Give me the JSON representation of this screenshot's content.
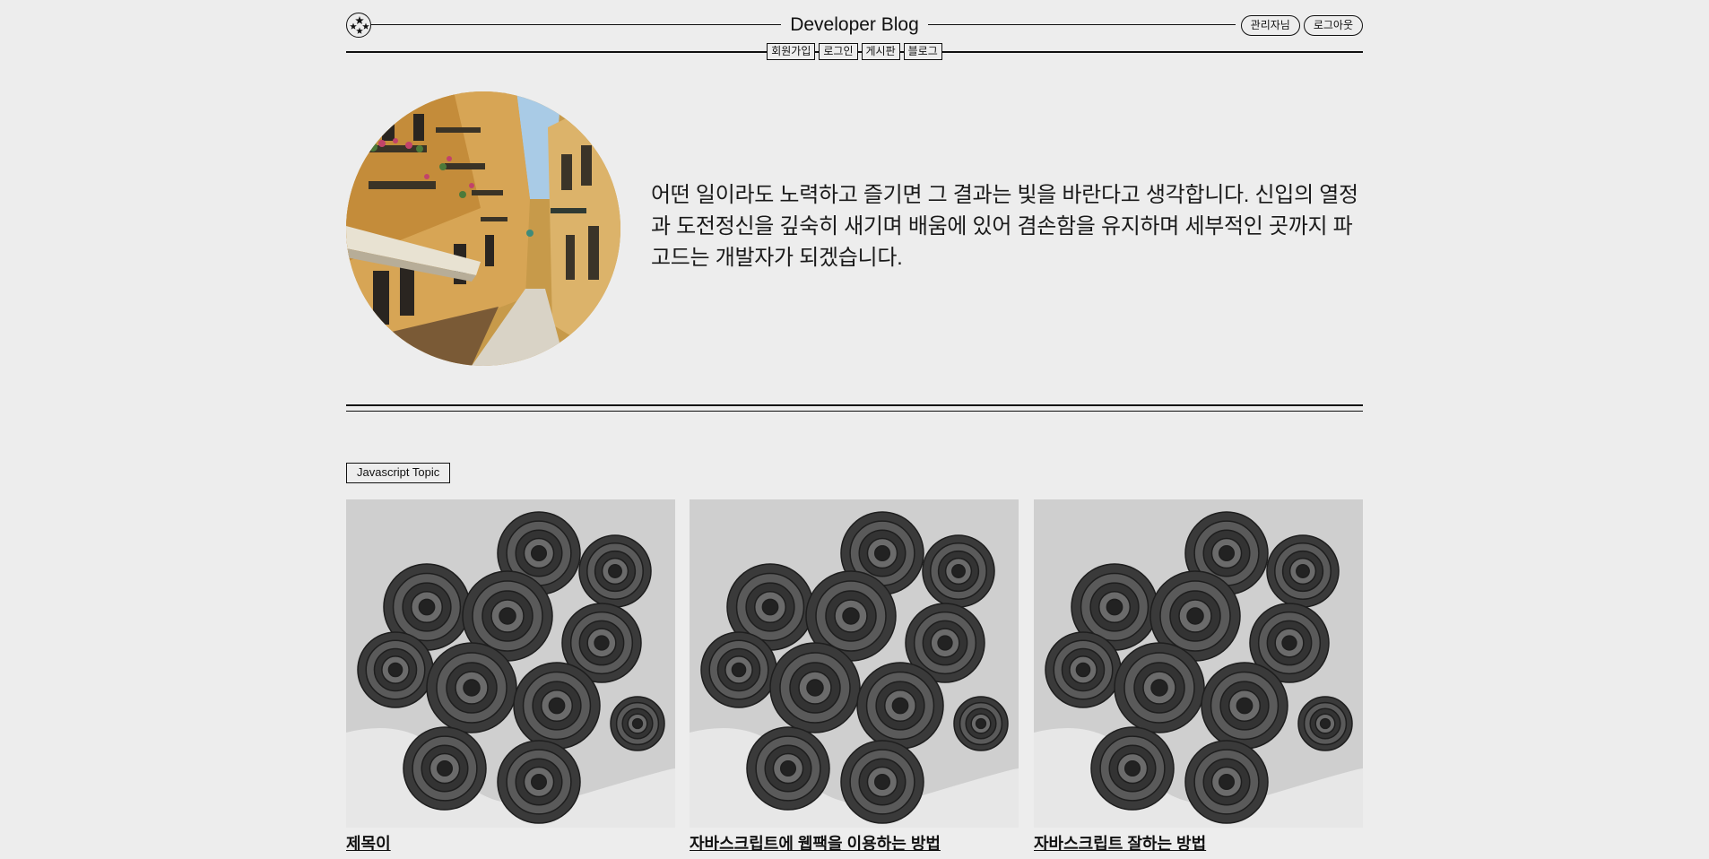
{
  "header": {
    "brand": "Developer Blog",
    "logo_icon": "star-circle-icon",
    "admin_label": "관리자님",
    "logout_label": "로그아웃"
  },
  "nav": {
    "items": [
      "회원가입",
      "로그인",
      "게시판",
      "블로그"
    ]
  },
  "hero": {
    "image_icon": "street-photo",
    "text": "어떤 일이라도 노력하고 즐기면 그 결과는 빛을 바란다고 생각합니다. 신입의 열정과 도전정신을 깊숙히 새기며 배움에 있어 겸손함을 유지하며 세부적인 곳까지 파고드는 개발자가 되겠습니다."
  },
  "topic": {
    "label": "Javascript Topic"
  },
  "posts": [
    {
      "title": "제목이",
      "image_icon": "roses-photo"
    },
    {
      "title": "자바스크립트에 웹팩을 이용하는 방법",
      "image_icon": "roses-photo"
    },
    {
      "title": "자바스크립트 잘하는 방법",
      "image_icon": "roses-photo"
    }
  ],
  "colors": {
    "background": "#ededed",
    "ink": "#111111"
  }
}
